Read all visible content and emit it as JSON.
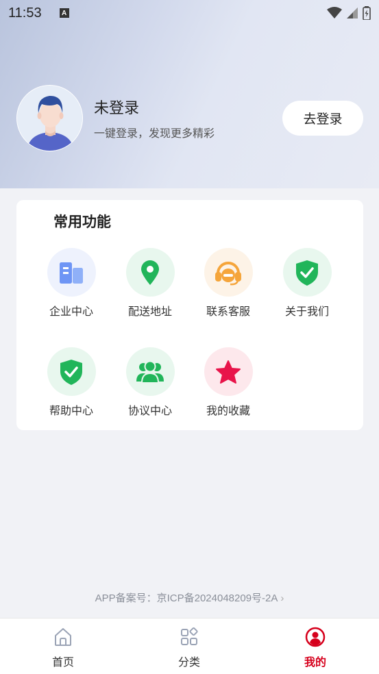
{
  "status_bar": {
    "time": "11:53",
    "notification_letter": "A"
  },
  "profile": {
    "name": "未登录",
    "subtitle": "一键登录，发现更多精彩",
    "login_label": "去登录"
  },
  "functions": {
    "title": "常用功能",
    "items": [
      {
        "label": "企业中心",
        "icon": "building-icon",
        "color": "#6e95f5",
        "bg": "#eef2fd"
      },
      {
        "label": "配送地址",
        "icon": "location-pin-icon",
        "color": "#21b55a",
        "bg": "#e8f7ee"
      },
      {
        "label": "联系客服",
        "icon": "headset-icon",
        "color": "#f5a53b",
        "bg": "#fdf3e7"
      },
      {
        "label": "关于我们",
        "icon": "shield-check-icon",
        "color": "#21b55a",
        "bg": "#e8f7ee"
      },
      {
        "label": "帮助中心",
        "icon": "shield-check-icon",
        "color": "#21b55a",
        "bg": "#e8f7ee"
      },
      {
        "label": "协议中心",
        "icon": "users-icon",
        "color": "#21b55a",
        "bg": "#e8f7ee"
      },
      {
        "label": "我的收藏",
        "icon": "star-icon",
        "color": "#e8144a",
        "bg": "#fde8ec"
      }
    ]
  },
  "footer": {
    "icp": "APP备案号：京ICP备2024048209号-2A"
  },
  "tabbar": {
    "active_color": "#d6001c",
    "tabs": [
      {
        "label": "首页",
        "icon": "home-icon"
      },
      {
        "label": "分类",
        "icon": "category-grid-icon"
      },
      {
        "label": "我的",
        "icon": "user-circle-icon",
        "active": true
      }
    ]
  }
}
